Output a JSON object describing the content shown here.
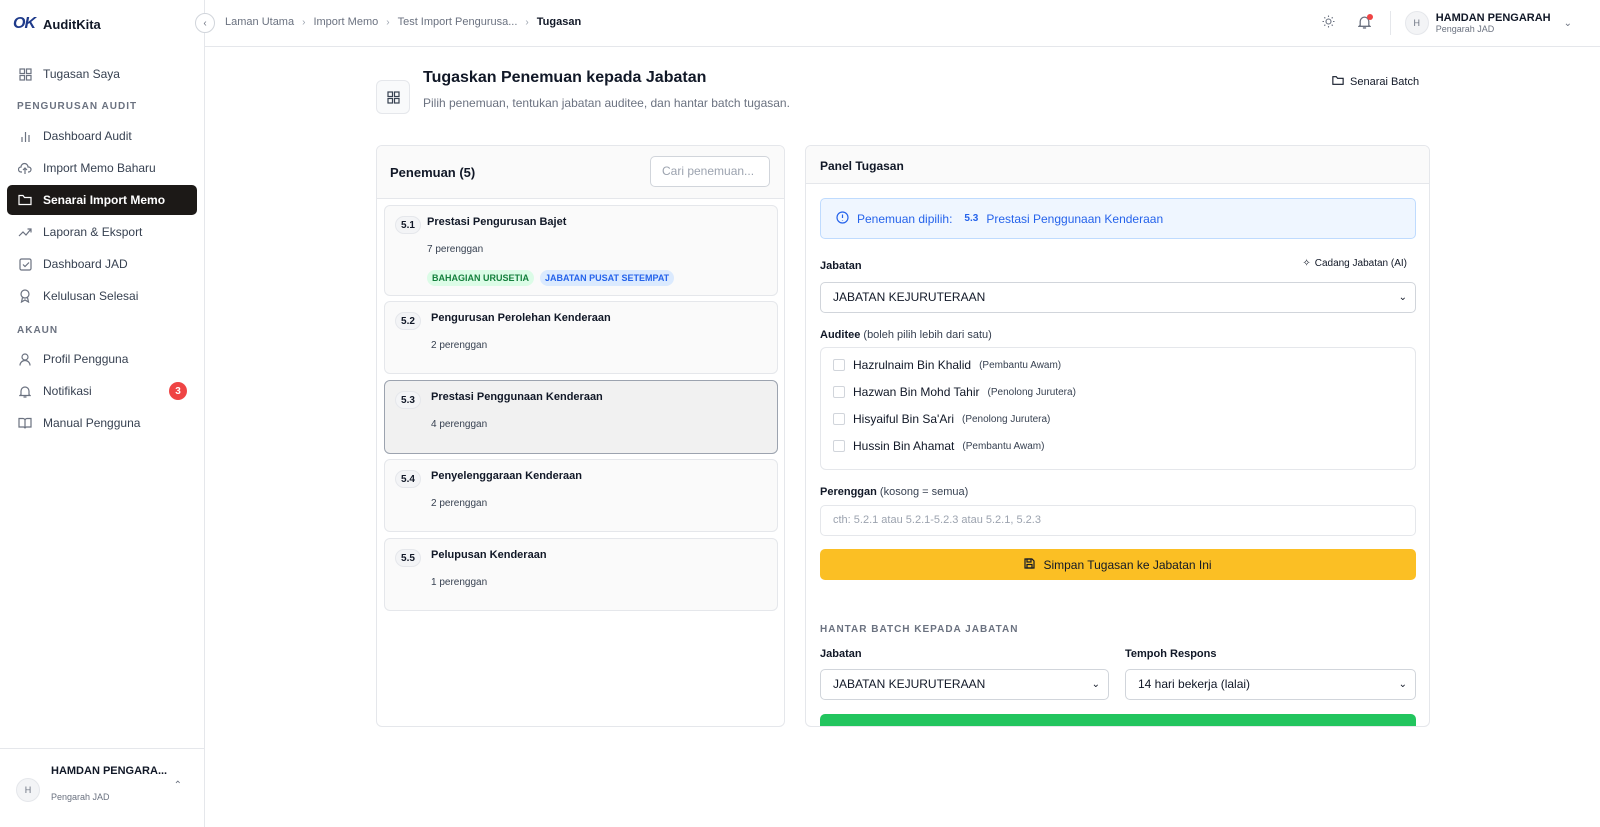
{
  "app": {
    "logo_mark": "OK",
    "name": "AuditKita"
  },
  "breadcrumb": [
    "Laman Utama",
    "Import Memo",
    "Test Import Pengurusa...",
    "Tugasan"
  ],
  "user": {
    "name_full": "HAMDAN PENGARAH",
    "name_short": "HAMDAN PENGARA...",
    "role": "Pengarah JAD",
    "initial": "H"
  },
  "sidebar": {
    "top_item": "Tugasan Saya",
    "section_audit": "PENGURUSAN AUDIT",
    "audit_items": [
      "Dashboard Audit",
      "Import Memo Baharu",
      "Senarai Import Memo",
      "Laporan & Eksport",
      "Dashboard JAD",
      "Kelulusan Selesai"
    ],
    "section_account": "AKAUN",
    "account_items": [
      "Profil Pengguna",
      "Notifikasi",
      "Manual Pengguna"
    ],
    "notif_count": "3"
  },
  "page": {
    "title": "Tugaskan Penemuan kepada Jabatan",
    "subtitle": "Pilih penemuan, tentukan jabatan auditee, dan hantar batch tugasan.",
    "batch_link": "Senarai Batch"
  },
  "findings": {
    "header": "Penemuan (5)",
    "search_placeholder": "Cari penemuan...",
    "items": [
      {
        "num": "5.1",
        "title": "Prestasi Pengurusan Bajet",
        "sub": "7 perenggan",
        "tags": [
          "BAHAGIAN URUSETIA",
          "JABATAN PUSAT SETEMPAT"
        ]
      },
      {
        "num": "5.2",
        "title": "Pengurusan Perolehan Kenderaan",
        "sub": "2 perenggan"
      },
      {
        "num": "5.3",
        "title": "Prestasi Penggunaan Kenderaan",
        "sub": "4 perenggan"
      },
      {
        "num": "5.4",
        "title": "Penyelenggaraan Kenderaan",
        "sub": "2 perenggan"
      },
      {
        "num": "5.5",
        "title": "Pelupusan Kenderaan",
        "sub": "1 perenggan"
      }
    ]
  },
  "panel": {
    "title": "Panel Tugasan",
    "info_label": "Penemuan dipilih:",
    "info_num": "5.3",
    "info_title": "Prestasi Penggunaan Kenderaan",
    "jabatan_label": "Jabatan",
    "ai_suggest": "Cadang Jabatan (AI)",
    "jabatan_value": "JABATAN KEJURUTERAAN",
    "auditee_label": "Auditee",
    "auditee_hint": "(boleh pilih lebih dari satu)",
    "auditees": [
      {
        "name": "Hazrulnaim Bin Khalid",
        "role": "(Pembantu Awam)"
      },
      {
        "name": "Hazwan Bin Mohd Tahir",
        "role": "(Penolong Jurutera)"
      },
      {
        "name": "Hisyaiful Bin Sa'Ari",
        "role": "(Penolong Jurutera)"
      },
      {
        "name": "Hussin Bin Ahamat",
        "role": "(Pembantu Awam)"
      }
    ],
    "perenggan_label": "Perenggan",
    "perenggan_hint": "(kosong = semua)",
    "perenggan_placeholder": "cth: 5.2.1 atau 5.2.1-5.2.3 atau 5.2.1, 5.2.3",
    "save_label": "Simpan Tugasan ke Jabatan Ini",
    "batch_section": "HANTAR BATCH KEPADA JABATAN",
    "batch_jabatan_label": "Jabatan",
    "batch_jabatan_value": "JABATAN KEJURUTERAAN",
    "tempoh_label": "Tempoh Respons",
    "tempoh_value": "14 hari bekerja (lalai)"
  },
  "colors": {
    "accent_yellow": "#fbbf24",
    "accent_green": "#22c55e",
    "active_nav": "#1c1917",
    "info_blue": "#2563eb"
  }
}
